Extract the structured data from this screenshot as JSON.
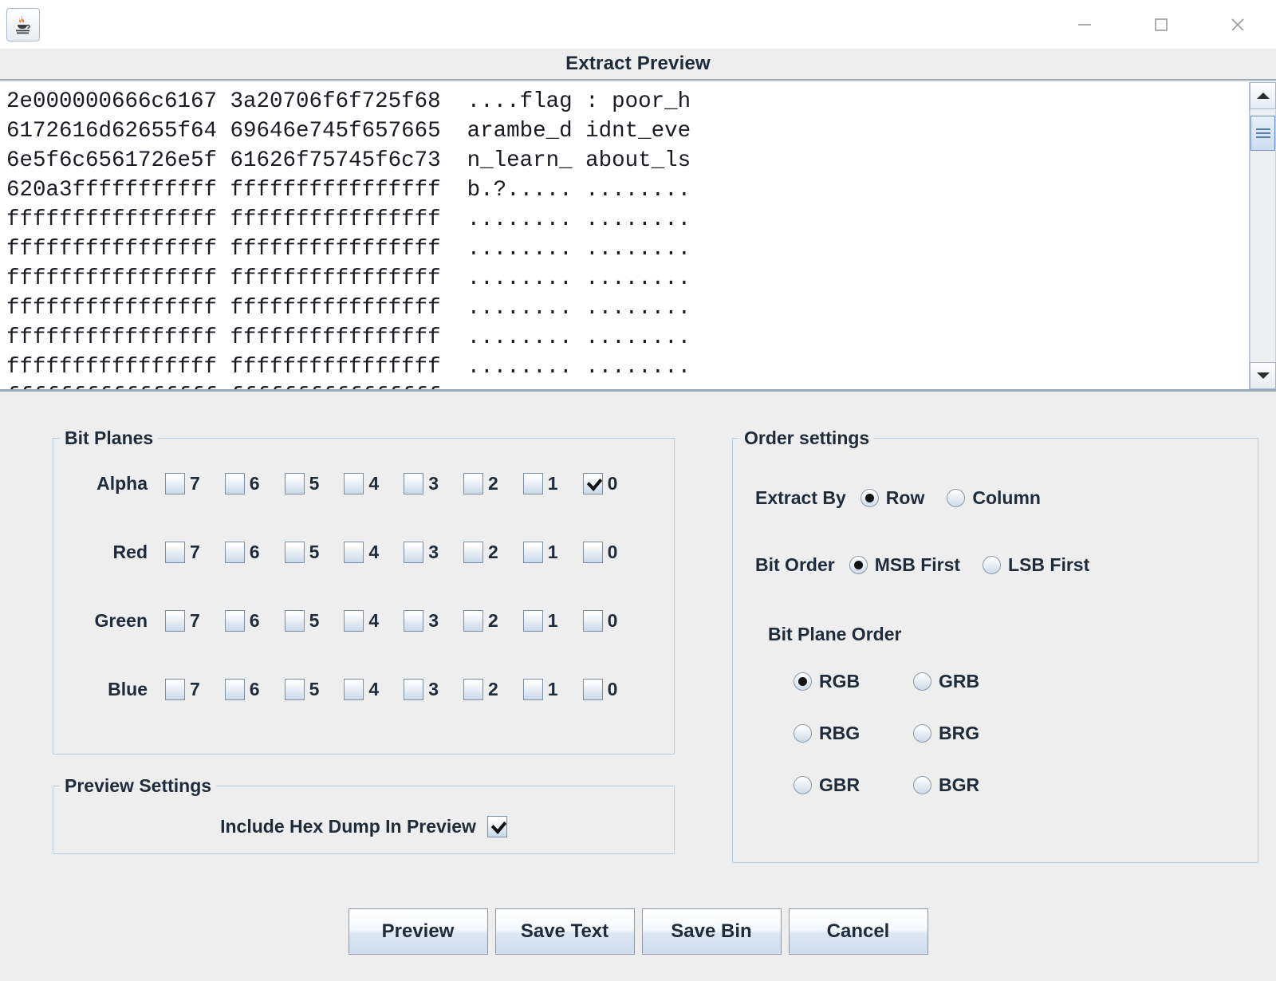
{
  "window": {
    "app_icon": "java-coffee-cup-icon",
    "minimize_label": "minimize-icon",
    "maximize_label": "maximize-icon",
    "close_label": "close-icon"
  },
  "header": {
    "title": "Extract Preview"
  },
  "preview": {
    "hex_dump": "2e000000666c6167 3a20706f6f725f68  ....flag : poor_h\n6172616d62655f64 69646e745f657665  arambe_d idnt_eve\n6e5f6c6561726e5f 61626f75745f6c73  n_learn_ about_ls\n620a3fffffffffff ffffffffffffffff  b.?..... ........\nffffffffffffffff ffffffffffffffff  ........ ........\nffffffffffffffff ffffffffffffffff  ........ ........\nffffffffffffffff ffffffffffffffff  ........ ........\nffffffffffffffff ffffffffffffffff  ........ ........\nffffffffffffffff ffffffffffffffff  ........ ........\nffffffffffffffff ffffffffffffffff  ........ ........\nffffffffffffffff ffffffffffffffff  ........ ........",
    "scrollbar": {
      "up_arrow": "scroll-up-icon",
      "down_arrow": "scroll-down-icon"
    }
  },
  "bit_planes": {
    "legend": "Bit Planes",
    "bits": [
      "7",
      "6",
      "5",
      "4",
      "3",
      "2",
      "1",
      "0"
    ],
    "rows": [
      {
        "label": "Alpha",
        "checked": [
          false,
          false,
          false,
          false,
          false,
          false,
          false,
          true
        ]
      },
      {
        "label": "Red",
        "checked": [
          false,
          false,
          false,
          false,
          false,
          false,
          false,
          false
        ]
      },
      {
        "label": "Green",
        "checked": [
          false,
          false,
          false,
          false,
          false,
          false,
          false,
          false
        ]
      },
      {
        "label": "Blue",
        "checked": [
          false,
          false,
          false,
          false,
          false,
          false,
          false,
          false
        ]
      }
    ]
  },
  "preview_settings": {
    "legend": "Preview Settings",
    "include_hex_dump_label": "Include Hex Dump In Preview",
    "include_hex_dump_checked": true
  },
  "order_settings": {
    "legend": "Order settings",
    "extract_by": {
      "label": "Extract By",
      "options": [
        "Row",
        "Column"
      ],
      "selected": "Row"
    },
    "bit_order": {
      "label": "Bit Order",
      "options": [
        "MSB First",
        "LSB First"
      ],
      "selected": "MSB First"
    },
    "bit_plane_order": {
      "label": "Bit Plane Order",
      "options": [
        "RGB",
        "GRB",
        "RBG",
        "BRG",
        "GBR",
        "BGR"
      ],
      "selected": "RGB"
    }
  },
  "buttons": [
    {
      "label": "Preview"
    },
    {
      "label": "Save Text"
    },
    {
      "label": "Save Bin"
    },
    {
      "label": "Cancel"
    }
  ],
  "colors": {
    "window_bg": "#eeeeee",
    "titlebar_bg": "#ffffff",
    "panel_border": "#b9cfe4",
    "text": "#1d2b3a",
    "hex_text": "#1a1a22",
    "accent": "#6f8fbe"
  }
}
